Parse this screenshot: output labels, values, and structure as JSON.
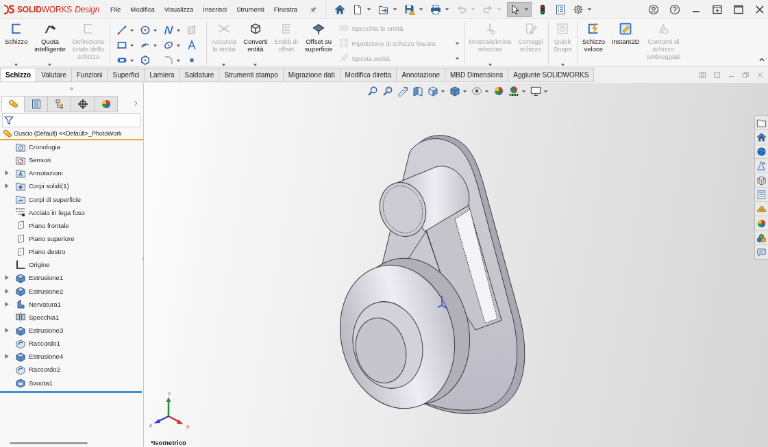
{
  "title_bar": {
    "logo": "**SOLID**WORKS *Design*",
    "menu": [
      "File",
      "Modifica",
      "Visualizza",
      "Inserisci",
      "Strumenti",
      "Finestra"
    ],
    "quick_access": [
      {
        "kind": "home",
        "dropdown": false,
        "disabled": false,
        "selected": false
      },
      {
        "kind": "new",
        "dropdown": true,
        "disabled": false,
        "selected": false
      },
      {
        "kind": "open",
        "dropdown": true,
        "disabled": false,
        "selected": false
      },
      {
        "kind": "save",
        "dropdown": true,
        "disabled": false,
        "selected": false
      },
      {
        "kind": "print",
        "dropdown": true,
        "disabled": false,
        "selected": false
      },
      {
        "kind": "undo",
        "dropdown": true,
        "disabled": true,
        "selected": false
      },
      {
        "kind": "redo",
        "dropdown": true,
        "disabled": true,
        "selected": false
      },
      {
        "kind": "select",
        "dropdown": true,
        "disabled": false,
        "selected": true
      },
      {
        "kind": "rebuild",
        "dropdown": false,
        "disabled": false,
        "selected": false
      },
      {
        "kind": "properties",
        "dropdown": false,
        "disabled": false,
        "selected": false
      },
      {
        "kind": "options",
        "dropdown": true,
        "disabled": false,
        "selected": false
      }
    ]
  },
  "ribbon": {
    "groups": [
      {
        "items": [
          {
            "kind": "sketch",
            "label": "Schizzo",
            "disabled": false,
            "dropdown": true
          },
          {
            "kind": "smart-dimension",
            "label": "Quota\nintelligente",
            "disabled": false,
            "dropdown": true
          },
          {
            "kind": "fully-define",
            "label": "Definizione\ntotale dello\nschizzo",
            "disabled": true,
            "dropdown": false
          }
        ]
      },
      {
        "grid": [
          {
            "kind": "line",
            "dropdown": true
          },
          {
            "kind": "circle",
            "dropdown": true
          },
          {
            "kind": "spline",
            "dropdown": true
          },
          {
            "kind": "plane",
            "dropdown": false
          },
          {
            "kind": "rectangle",
            "dropdown": true
          },
          {
            "kind": "arc",
            "dropdown": true
          },
          {
            "kind": "ellipse",
            "dropdown": true
          },
          {
            "kind": "text",
            "dropdown": false
          },
          {
            "kind": "slot",
            "dropdown": true
          },
          {
            "kind": "polygon",
            "dropdown": false
          },
          {
            "kind": "sketch-fillet",
            "dropdown": true
          },
          {
            "kind": "point",
            "dropdown": false
          }
        ]
      },
      {
        "items": [
          {
            "kind": "trim",
            "label": "Accorcia\nle entità",
            "disabled": true,
            "dropdown": true
          },
          {
            "kind": "convert",
            "label": "Converti\nentità",
            "disabled": false,
            "dropdown": true
          },
          {
            "kind": "offset",
            "label": "Entità di\noffset",
            "disabled": true,
            "dropdown": false
          },
          {
            "kind": "offset-surface",
            "label": "Offset su\nsuperficie",
            "disabled": false,
            "dropdown": false
          }
        ],
        "rows": [
          {
            "kind": "mirror",
            "label": "Specchia le entità",
            "disabled": true,
            "dropdown": false
          },
          {
            "kind": "linear-pattern",
            "label": "Ripetizione di schizzo lineare",
            "disabled": true,
            "dropdown": true
          },
          {
            "kind": "move",
            "label": "Sposta entità",
            "disabled": true,
            "dropdown": true
          }
        ]
      },
      {
        "items": [
          {
            "kind": "relations",
            "label": "Mostra/elimina\nrelazioni",
            "disabled": true,
            "dropdown": true
          },
          {
            "kind": "repair",
            "label": "Correggi\nschizzo",
            "disabled": true,
            "dropdown": false
          }
        ]
      },
      {
        "items": [
          {
            "kind": "quick-snaps",
            "label": "Quick\nSnaps",
            "disabled": true,
            "dropdown": true
          }
        ]
      },
      {
        "items": [
          {
            "kind": "quick-sketch",
            "label": "Schizzo\nveloce",
            "disabled": false,
            "dropdown": false
          },
          {
            "kind": "instant2d",
            "label": "Instant2D",
            "disabled": false,
            "dropdown": false
          },
          {
            "kind": "shaded-contours",
            "label": "Contorni di\nschizzo\nombreggiati",
            "disabled": true,
            "dropdown": false
          }
        ]
      }
    ]
  },
  "command_tabs": [
    {
      "label": "Schizzo",
      "selected": true
    },
    {
      "label": "Valutare",
      "selected": false
    },
    {
      "label": "Funzioni",
      "selected": false
    },
    {
      "label": "Superfici",
      "selected": false
    },
    {
      "label": "Lamiera",
      "selected": false
    },
    {
      "label": "Saldature",
      "selected": false
    },
    {
      "label": "Strumenti stampo",
      "selected": false
    },
    {
      "label": "Migrazione dati",
      "selected": false
    },
    {
      "label": "Modifica diretta",
      "selected": false
    },
    {
      "label": "Annotazione",
      "selected": false
    },
    {
      "label": "MBD Dimensions",
      "selected": false
    },
    {
      "label": "Aggiunte SOLIDWORKS",
      "selected": false
    }
  ],
  "feature_manager": {
    "tabs": [
      {
        "kind": "features",
        "selected": true
      },
      {
        "kind": "properties",
        "selected": false
      },
      {
        "kind": "configurations",
        "selected": false
      },
      {
        "kind": "dimxpert",
        "selected": false
      },
      {
        "kind": "display",
        "selected": false
      }
    ],
    "tree": {
      "label": "Guscio (Default) <<Default>_PhotoWork",
      "kind": "part",
      "children": [
        {
          "label": "Cronologia",
          "kind": "history",
          "expandable": false
        },
        {
          "label": "Sensori",
          "kind": "sensors",
          "expandable": false
        },
        {
          "label": "Annotazioni",
          "kind": "annotations",
          "expandable": true
        },
        {
          "label": "Corpi solidi(1)",
          "kind": "solid-bodies",
          "expandable": true
        },
        {
          "label": "Corpi di superficie",
          "kind": "surface-bodies",
          "expandable": false
        },
        {
          "label": "Acciaio in lega fuso",
          "kind": "material",
          "expandable": false
        },
        {
          "label": "Piano frontale",
          "kind": "ref-plane",
          "expandable": false
        },
        {
          "label": "Piano superiore",
          "kind": "ref-plane",
          "expandable": false
        },
        {
          "label": "Piano destro",
          "kind": "ref-plane",
          "expandable": false
        },
        {
          "label": "Origine",
          "kind": "origin",
          "expandable": false
        },
        {
          "label": "Estrusione1",
          "kind": "extrude",
          "expandable": true
        },
        {
          "label": "Estrusione2",
          "kind": "extrude",
          "expandable": true
        },
        {
          "label": "Nervatura1",
          "kind": "rib",
          "expandable": true
        },
        {
          "label": "Specchia1",
          "kind": "mirror-feature",
          "expandable": false
        },
        {
          "label": "Estrusione3",
          "kind": "extrude",
          "expandable": true
        },
        {
          "label": "Raccordo1",
          "kind": "fillet",
          "expandable": false
        },
        {
          "label": "Estrusione4",
          "kind": "extrude",
          "expandable": true
        },
        {
          "label": "Raccordo2",
          "kind": "fillet",
          "expandable": false
        },
        {
          "label": "Svuota1",
          "kind": "shell",
          "expandable": false
        }
      ]
    }
  },
  "viewport": {
    "view_toolbar": [
      {
        "kind": "zoom-fit",
        "dropdown": false
      },
      {
        "kind": "zoom-area",
        "dropdown": false
      },
      {
        "kind": "previous-view",
        "dropdown": false
      },
      {
        "kind": "section-view",
        "dropdown": false
      },
      {
        "kind": "view-orientation",
        "dropdown": true
      },
      {
        "kind": "display-style",
        "dropdown": true
      },
      {
        "kind": "hide-show",
        "dropdown": true
      },
      {
        "kind": "appearance",
        "dropdown": false
      },
      {
        "kind": "scene",
        "dropdown": true
      },
      {
        "kind": "view-settings",
        "dropdown": true
      }
    ],
    "triad": {
      "x": "X",
      "y": "Y",
      "z": "Z"
    },
    "view_name": "*Isometrico"
  }
}
